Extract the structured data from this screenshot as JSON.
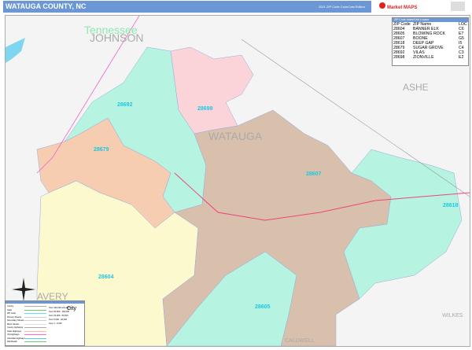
{
  "header": {
    "title": "WATAUGA COUNTY, NC",
    "edition": "2021 ZIP Code ColorCast Edition",
    "logo_text": "Market MAPS"
  },
  "zip_index": {
    "title": "ZIP Code Index/Grid Locator",
    "columns": [
      "ZIP Code",
      "ZIP Name",
      "LOC"
    ],
    "rows": [
      [
        "28604",
        "BANNER ELK",
        "C6"
      ],
      [
        "28605",
        "BLOWING ROCK",
        "E7"
      ],
      [
        "28607",
        "BOONE",
        "G5"
      ],
      [
        "28618",
        "DEEP GAP",
        "I5"
      ],
      [
        "28679",
        "SUGAR GROVE",
        "C4"
      ],
      [
        "28692",
        "VILAS",
        "C3"
      ],
      [
        "28698",
        "ZIONVILLE",
        "E2"
      ]
    ]
  },
  "map_labels": {
    "state": "Tennessee",
    "county_main": "WATAUGA",
    "neighbors": [
      "JOHNSON",
      "ASHE",
      "AVERY",
      "WILKES",
      "CALDWELL"
    ]
  },
  "zip_labels": [
    "28692",
    "28698",
    "28679",
    "28607",
    "28618",
    "28604",
    "28605"
  ],
  "legend": {
    "items": [
      "County",
      "State",
      "ZIP Code",
      "Primary Streets",
      "Secondary Streets",
      "Minor Streets",
      "County Highways",
      "State Highways",
      "US Highways",
      "Interstate Highways",
      "Rail Roads"
    ],
    "populated": [
      "Over 100,000 and above",
      "Over 50,000 - 100,000",
      "Over 20,000 - 50,000",
      "Over 5,000 - 20,000",
      "Over 1 - 5,000"
    ],
    "city_glyph": "City"
  },
  "colors": {
    "cyan": "#b6f3e1",
    "pink": "#fbd4da",
    "peach": "#f6cdb0",
    "yellow": "#fdf9cf",
    "tan": "#d8c0ac",
    "header": "#6b97d4"
  }
}
